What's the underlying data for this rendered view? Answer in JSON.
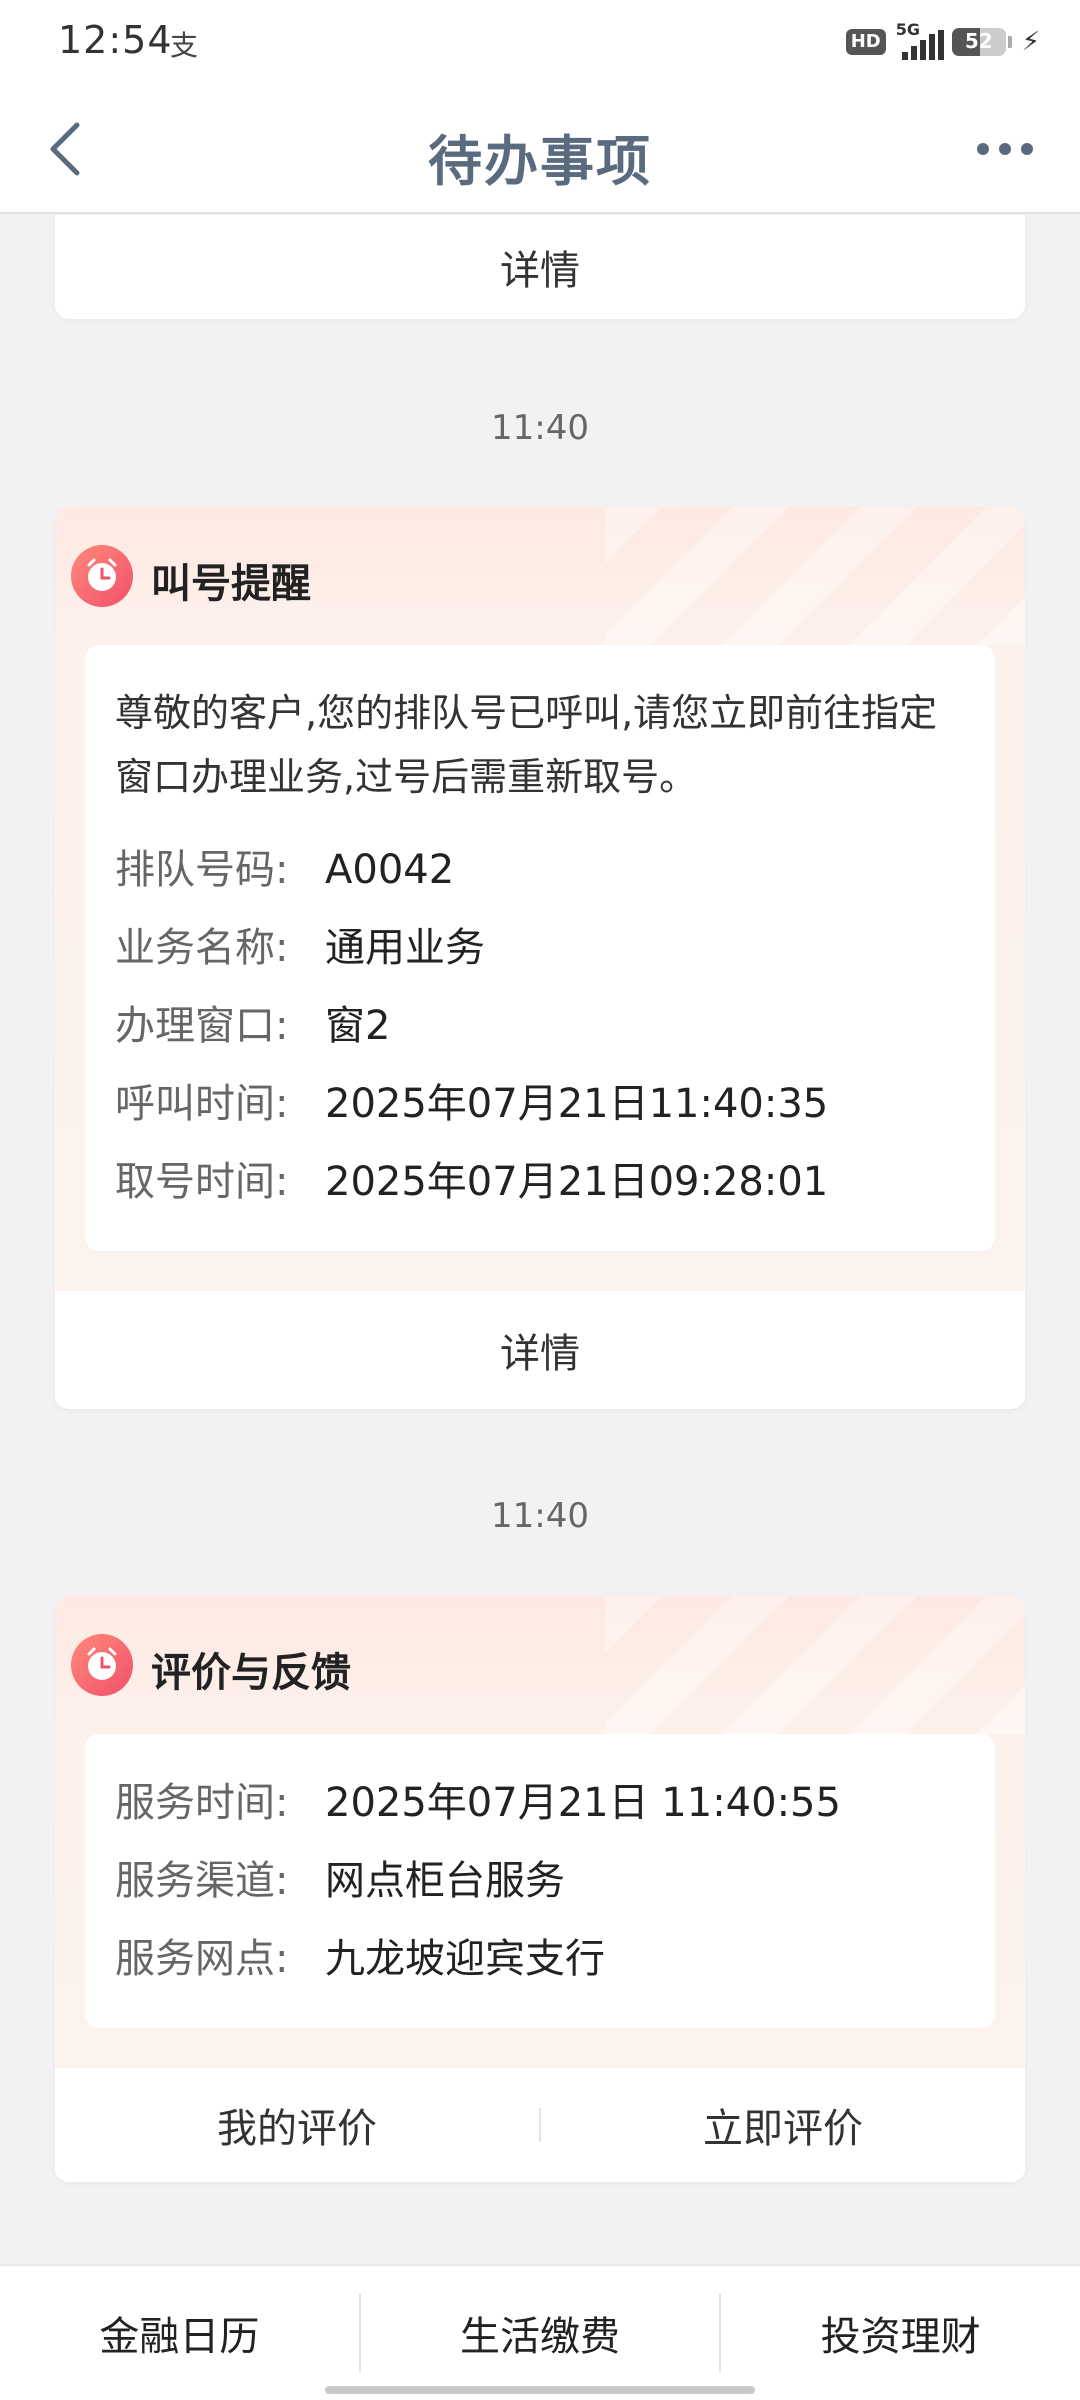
{
  "status_bar": {
    "time": "12:54",
    "app_icon_glyph": "支",
    "hd": "HD",
    "network": "5G",
    "battery_level": "52"
  },
  "header": {
    "title": "待办事项",
    "back_icon": "chevron-left-icon",
    "more_icon": "more-horizontal-icon"
  },
  "top_card": {
    "detail_label": "详情"
  },
  "queue_card": {
    "time": "11:40",
    "title": "叫号提醒",
    "message": "尊敬的客户,您的排队号已呼叫,请您立即前往指定窗口办理业务,过号后需重新取号。",
    "fields": [
      {
        "label": "排队号码:",
        "value": "A0042"
      },
      {
        "label": "业务名称:",
        "value": "通用业务"
      },
      {
        "label": "办理窗口:",
        "value": "窗2"
      },
      {
        "label": "呼叫时间:",
        "value": "2025年07月21日11:40:35"
      },
      {
        "label": "取号时间:",
        "value": "2025年07月21日09:28:01"
      }
    ],
    "detail_label": "详情"
  },
  "feedback_card": {
    "time": "11:40",
    "title": "评价与反馈",
    "fields": [
      {
        "label": "服务时间:",
        "value": "2025年07月21日 11:40:55"
      },
      {
        "label": "服务渠道:",
        "value": "网点柜台服务"
      },
      {
        "label": "服务网点:",
        "value": "九龙坡迎宾支行"
      }
    ],
    "my_review_label": "我的评价",
    "review_now_label": "立即评价"
  },
  "bottom_nav": {
    "items": [
      "金融日历",
      "生活缴费",
      "投资理财"
    ]
  },
  "colors": {
    "title": "#5a6b80",
    "card_header_tint": "#fde9e2",
    "icon_gradient_start": "#ff8a7a",
    "icon_gradient_end": "#f0506a"
  }
}
